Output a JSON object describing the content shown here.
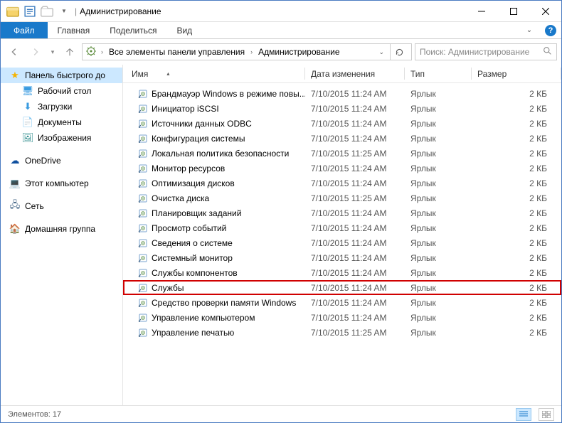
{
  "titlebar": {
    "title": "Администрирование"
  },
  "ribbon": {
    "file": "Файл",
    "home": "Главная",
    "share": "Поделиться",
    "view": "Вид"
  },
  "addressbar": {
    "crumb1": "Все элементы панели управления",
    "crumb2": "Администрирование"
  },
  "search": {
    "placeholder": "Поиск: Администрирование"
  },
  "navpane": {
    "quick": "Панель быстрого до",
    "desktop": "Рабочий стол",
    "downloads": "Загрузки",
    "documents": "Документы",
    "pictures": "Изображения",
    "onedrive": "OneDrive",
    "thispc": "Этот компьютер",
    "network": "Сеть",
    "homegroup": "Домашняя группа"
  },
  "columns": {
    "name": "Имя",
    "date": "Дата изменения",
    "type": "Тип",
    "size": "Размер"
  },
  "typeLabel": "Ярлык",
  "sizeLabel": "2 КБ",
  "files": [
    {
      "name": "Брандмауэр Windows в режиме повы...",
      "date": "7/10/2015 11:24 AM"
    },
    {
      "name": "Инициатор iSCSI",
      "date": "7/10/2015 11:24 AM"
    },
    {
      "name": "Источники данных ODBC",
      "date": "7/10/2015 11:24 AM"
    },
    {
      "name": "Конфигурация системы",
      "date": "7/10/2015 11:24 AM"
    },
    {
      "name": "Локальная политика безопасности",
      "date": "7/10/2015 11:25 AM"
    },
    {
      "name": "Монитор ресурсов",
      "date": "7/10/2015 11:24 AM"
    },
    {
      "name": "Оптимизация дисков",
      "date": "7/10/2015 11:24 AM"
    },
    {
      "name": "Очистка диска",
      "date": "7/10/2015 11:25 AM"
    },
    {
      "name": "Планировщик заданий",
      "date": "7/10/2015 11:24 AM"
    },
    {
      "name": "Просмотр событий",
      "date": "7/10/2015 11:24 AM"
    },
    {
      "name": "Сведения о системе",
      "date": "7/10/2015 11:24 AM"
    },
    {
      "name": "Системный монитор",
      "date": "7/10/2015 11:24 AM"
    },
    {
      "name": "Службы компонентов",
      "date": "7/10/2015 11:24 AM"
    },
    {
      "name": "Службы",
      "date": "7/10/2015 11:24 AM",
      "highlighted": true
    },
    {
      "name": "Средство проверки памяти Windows",
      "date": "7/10/2015 11:24 AM"
    },
    {
      "name": "Управление компьютером",
      "date": "7/10/2015 11:24 AM"
    },
    {
      "name": "Управление печатью",
      "date": "7/10/2015 11:25 AM"
    }
  ],
  "statusbar": {
    "count": "Элементов: 17"
  }
}
